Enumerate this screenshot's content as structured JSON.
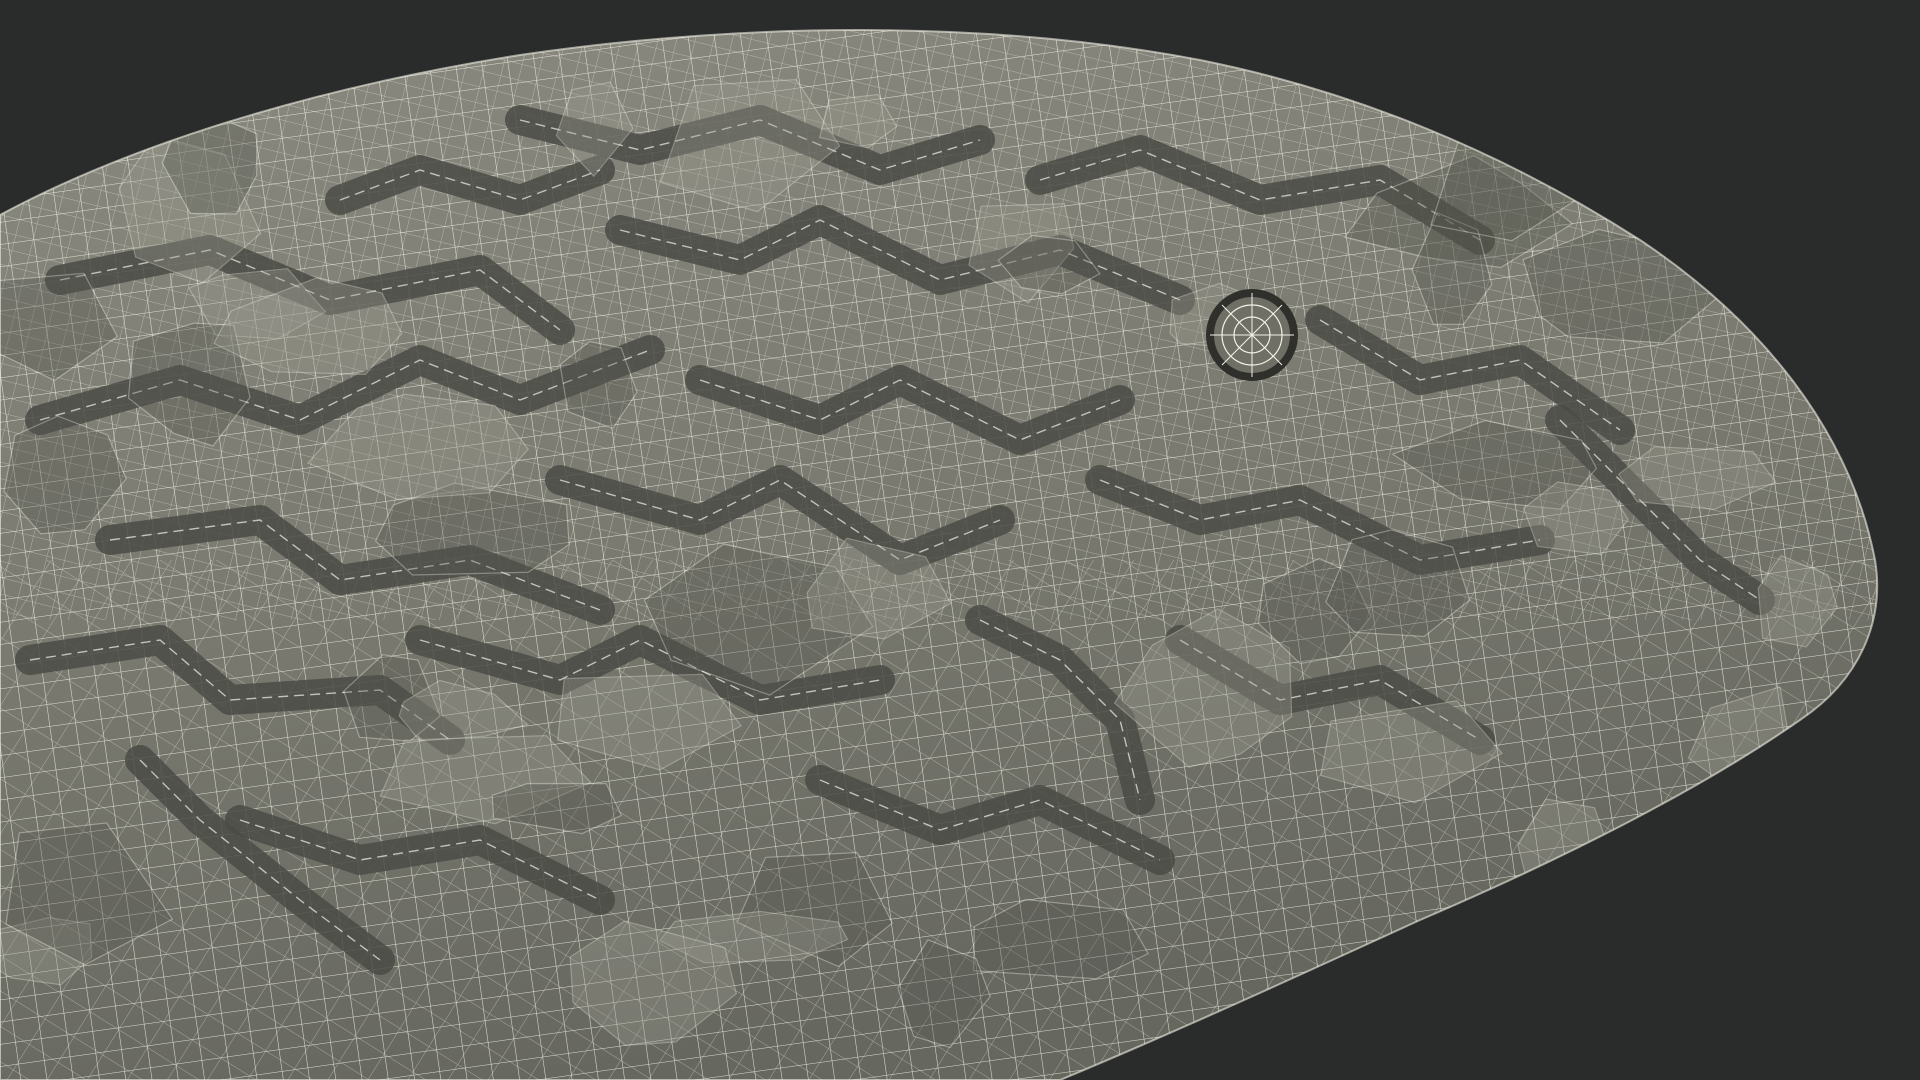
{
  "scene": {
    "background_color": "#2a2b2b",
    "surface_color": "#7c7c72",
    "surface_shadow_color": "#55564f",
    "surface_highlight_color": "#9a9a8f",
    "wire_color": "#f2f2e6",
    "groove_color": "#4a4b45"
  }
}
